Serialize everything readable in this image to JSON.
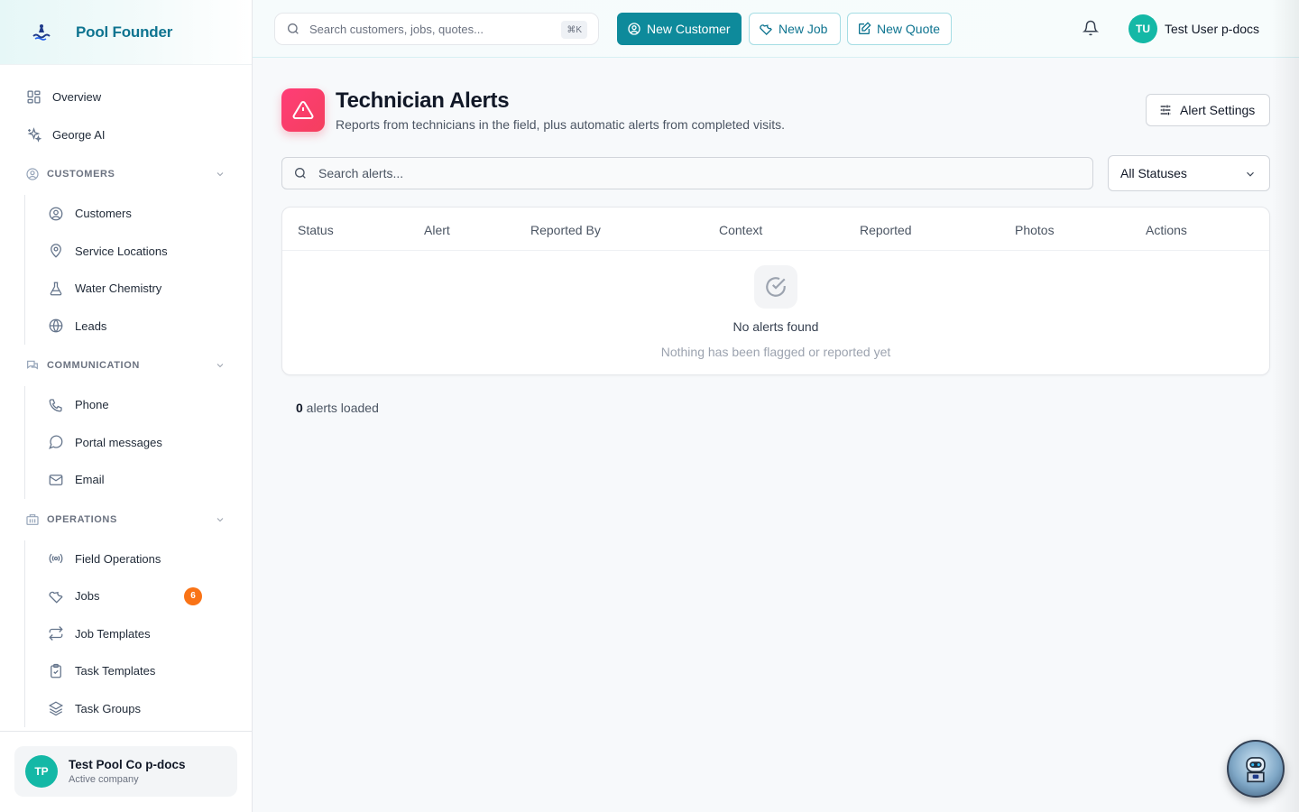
{
  "brand": {
    "name": "Pool Founder"
  },
  "sidebar": {
    "top_items": [
      {
        "label": "Overview",
        "icon": "grid-icon"
      },
      {
        "label": "George AI",
        "icon": "sparkles-icon"
      }
    ],
    "sections": [
      {
        "title": "CUSTOMERS",
        "icon": "user-circle-icon",
        "items": [
          {
            "label": "Customers",
            "icon": "user-circle-icon"
          },
          {
            "label": "Service Locations",
            "icon": "map-pin-icon"
          },
          {
            "label": "Water Chemistry",
            "icon": "flask-icon"
          },
          {
            "label": "Leads",
            "icon": "globe-icon"
          }
        ]
      },
      {
        "title": "COMMUNICATION",
        "icon": "chat-icon",
        "items": [
          {
            "label": "Phone",
            "icon": "phone-icon"
          },
          {
            "label": "Portal messages",
            "icon": "message-circle-icon"
          },
          {
            "label": "Email",
            "icon": "mail-icon"
          }
        ]
      },
      {
        "title": "OPERATIONS",
        "icon": "building-icon",
        "items": [
          {
            "label": "Field Operations",
            "icon": "radio-icon"
          },
          {
            "label": "Jobs",
            "icon": "wrench-icon",
            "badge": "6"
          },
          {
            "label": "Job Templates",
            "icon": "repeat-icon"
          },
          {
            "label": "Task Templates",
            "icon": "clipboard-icon"
          },
          {
            "label": "Task Groups",
            "icon": "layers-icon"
          }
        ]
      }
    ],
    "company": {
      "initials": "TP",
      "name": "Test Pool Co p-docs",
      "status": "Active company"
    }
  },
  "header": {
    "search_placeholder": "Search customers, jobs, quotes...",
    "search_shortcut": "⌘K",
    "new_customer": "New Customer",
    "new_job": "New Job",
    "new_quote": "New Quote",
    "user": {
      "initials": "TU",
      "name": "Test User p-docs"
    }
  },
  "main": {
    "title": "Technician Alerts",
    "subtitle": "Reports from technicians in the field, plus automatic alerts from completed visits.",
    "settings_label": "Alert Settings",
    "search_placeholder": "Search alerts...",
    "status_filter": "All Statuses",
    "columns": [
      "Status",
      "Alert",
      "Reported By",
      "Context",
      "Reported",
      "Photos",
      "Actions"
    ],
    "empty_title": "No alerts found",
    "empty_subtitle": "Nothing has been flagged or reported yet",
    "count": "0",
    "count_suffix": " alerts loaded"
  },
  "colors": {
    "accent": "#0e8a9b",
    "alert": "#f43f5e",
    "badge": "#f97316",
    "avatar": "#14b8a6"
  }
}
